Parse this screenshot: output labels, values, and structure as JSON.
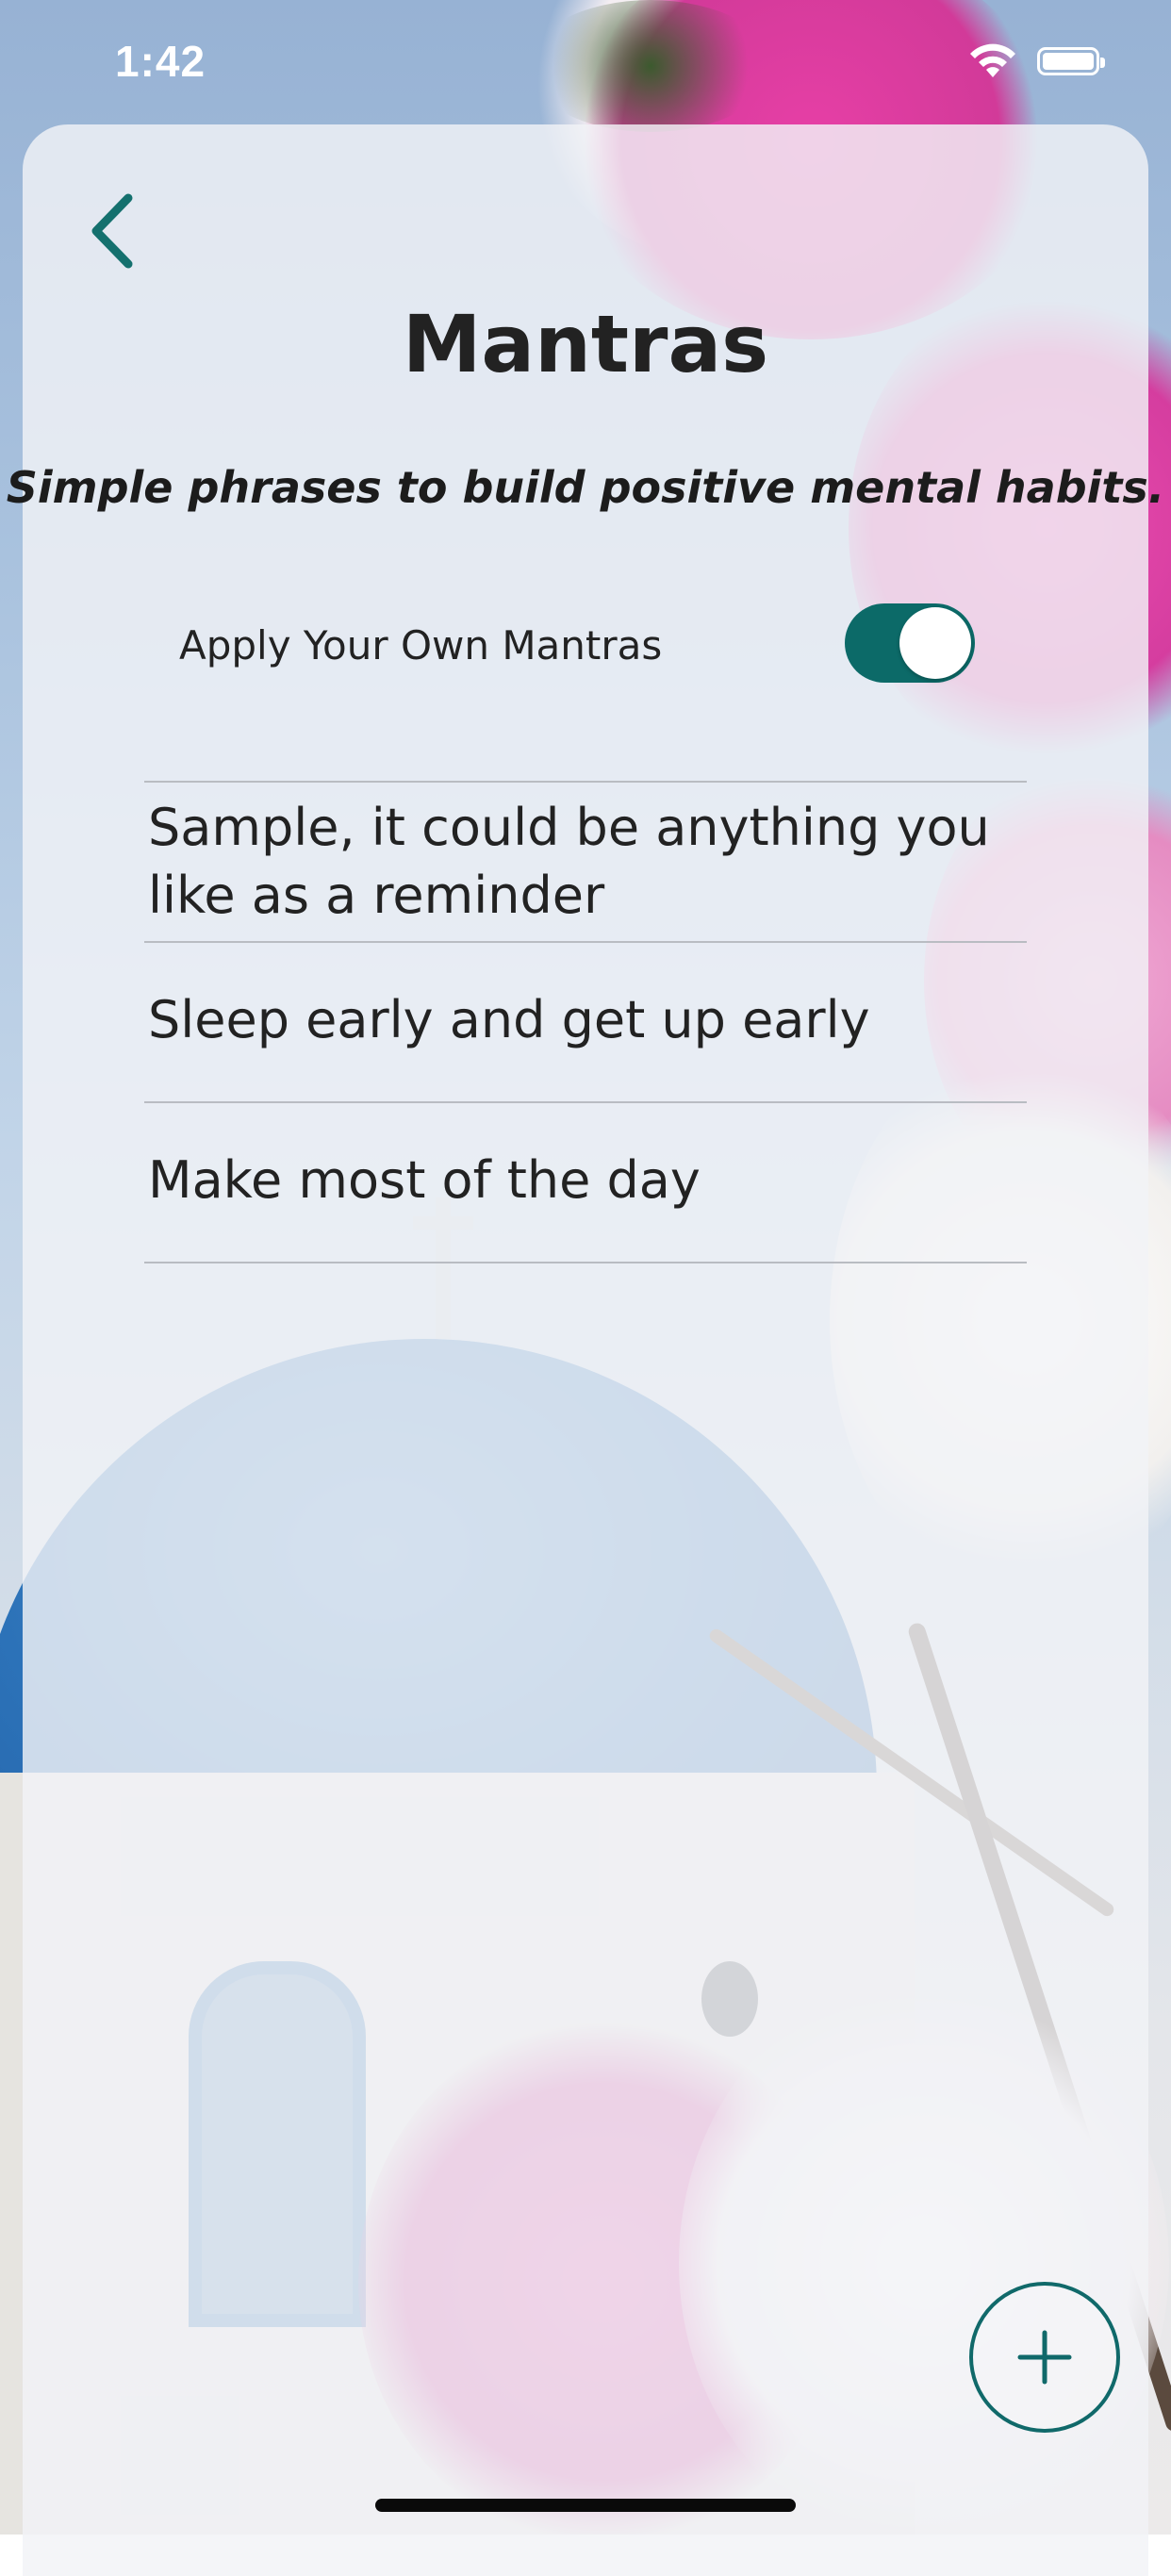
{
  "status_bar": {
    "time": "1:42"
  },
  "header": {
    "back_icon": "chevron-left-icon",
    "title": "Mantras",
    "subtitle": "Simple phrases to build positive mental habits."
  },
  "settings": {
    "apply_own_label": "Apply Your Own Mantras",
    "apply_own_enabled": true
  },
  "mantras": [
    "Sample, it could be anything you like as a reminder",
    "Sleep early and get up early",
    "Make most of the day"
  ],
  "fab": {
    "icon": "plus-icon"
  },
  "colors": {
    "accent": "#0c6a68",
    "text": "#222222"
  }
}
